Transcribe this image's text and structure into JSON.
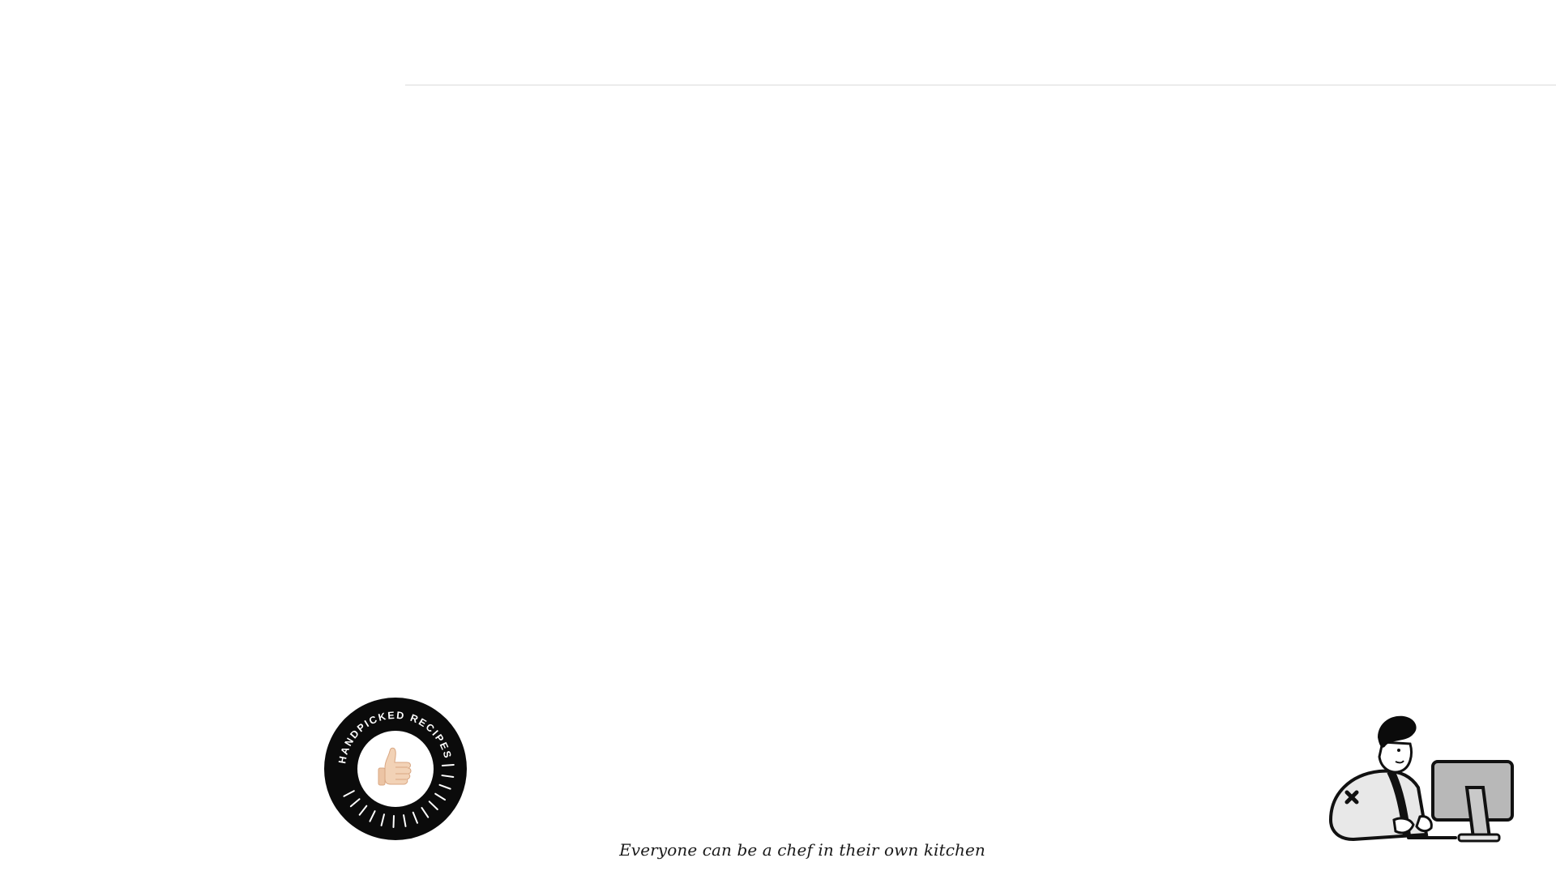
{
  "badge": {
    "text": "HANDPICKED RECIPES",
    "icon": "thumbs-up-icon",
    "colors": {
      "ring": "#0b0b0b",
      "center": "#ffffff",
      "text": "#ffffff",
      "hand": "#f2d2b6"
    }
  },
  "footer": {
    "tagline": "Everyone can be a chef in their own kitchen"
  },
  "illustration": {
    "icon": "person-at-computer-icon"
  }
}
